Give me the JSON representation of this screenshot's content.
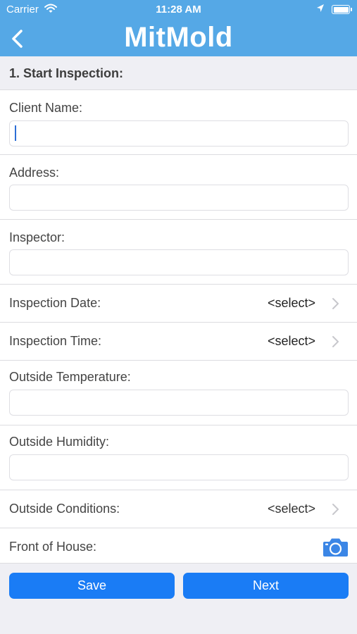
{
  "status_bar": {
    "carrier": "Carrier",
    "time": "11:28 AM"
  },
  "nav": {
    "title": "MitMold",
    "back_icon": "chevron-left-icon"
  },
  "section": {
    "title": "1. Start Inspection:"
  },
  "form": {
    "client_name": {
      "label": "Client Name:",
      "value": ""
    },
    "address": {
      "label": "Address:",
      "value": ""
    },
    "inspector": {
      "label": "Inspector:",
      "value": ""
    },
    "inspection_date": {
      "label": "Inspection Date:",
      "value": "<select>"
    },
    "inspection_time": {
      "label": "Inspection Time:",
      "value": "<select>"
    },
    "outside_temperature": {
      "label": "Outside Temperature:",
      "value": ""
    },
    "outside_humidity": {
      "label": "Outside Humidity:",
      "value": ""
    },
    "outside_conditions": {
      "label": "Outside Conditions:",
      "value": "<select>"
    },
    "front_of_house": {
      "label": "Front of House:",
      "icon": "camera-icon"
    }
  },
  "buttons": {
    "save": "Save",
    "next": "Next"
  },
  "colors": {
    "nav_background": "#55a8e6",
    "button": "#1a7cf5",
    "camera": "#3b86e6"
  }
}
